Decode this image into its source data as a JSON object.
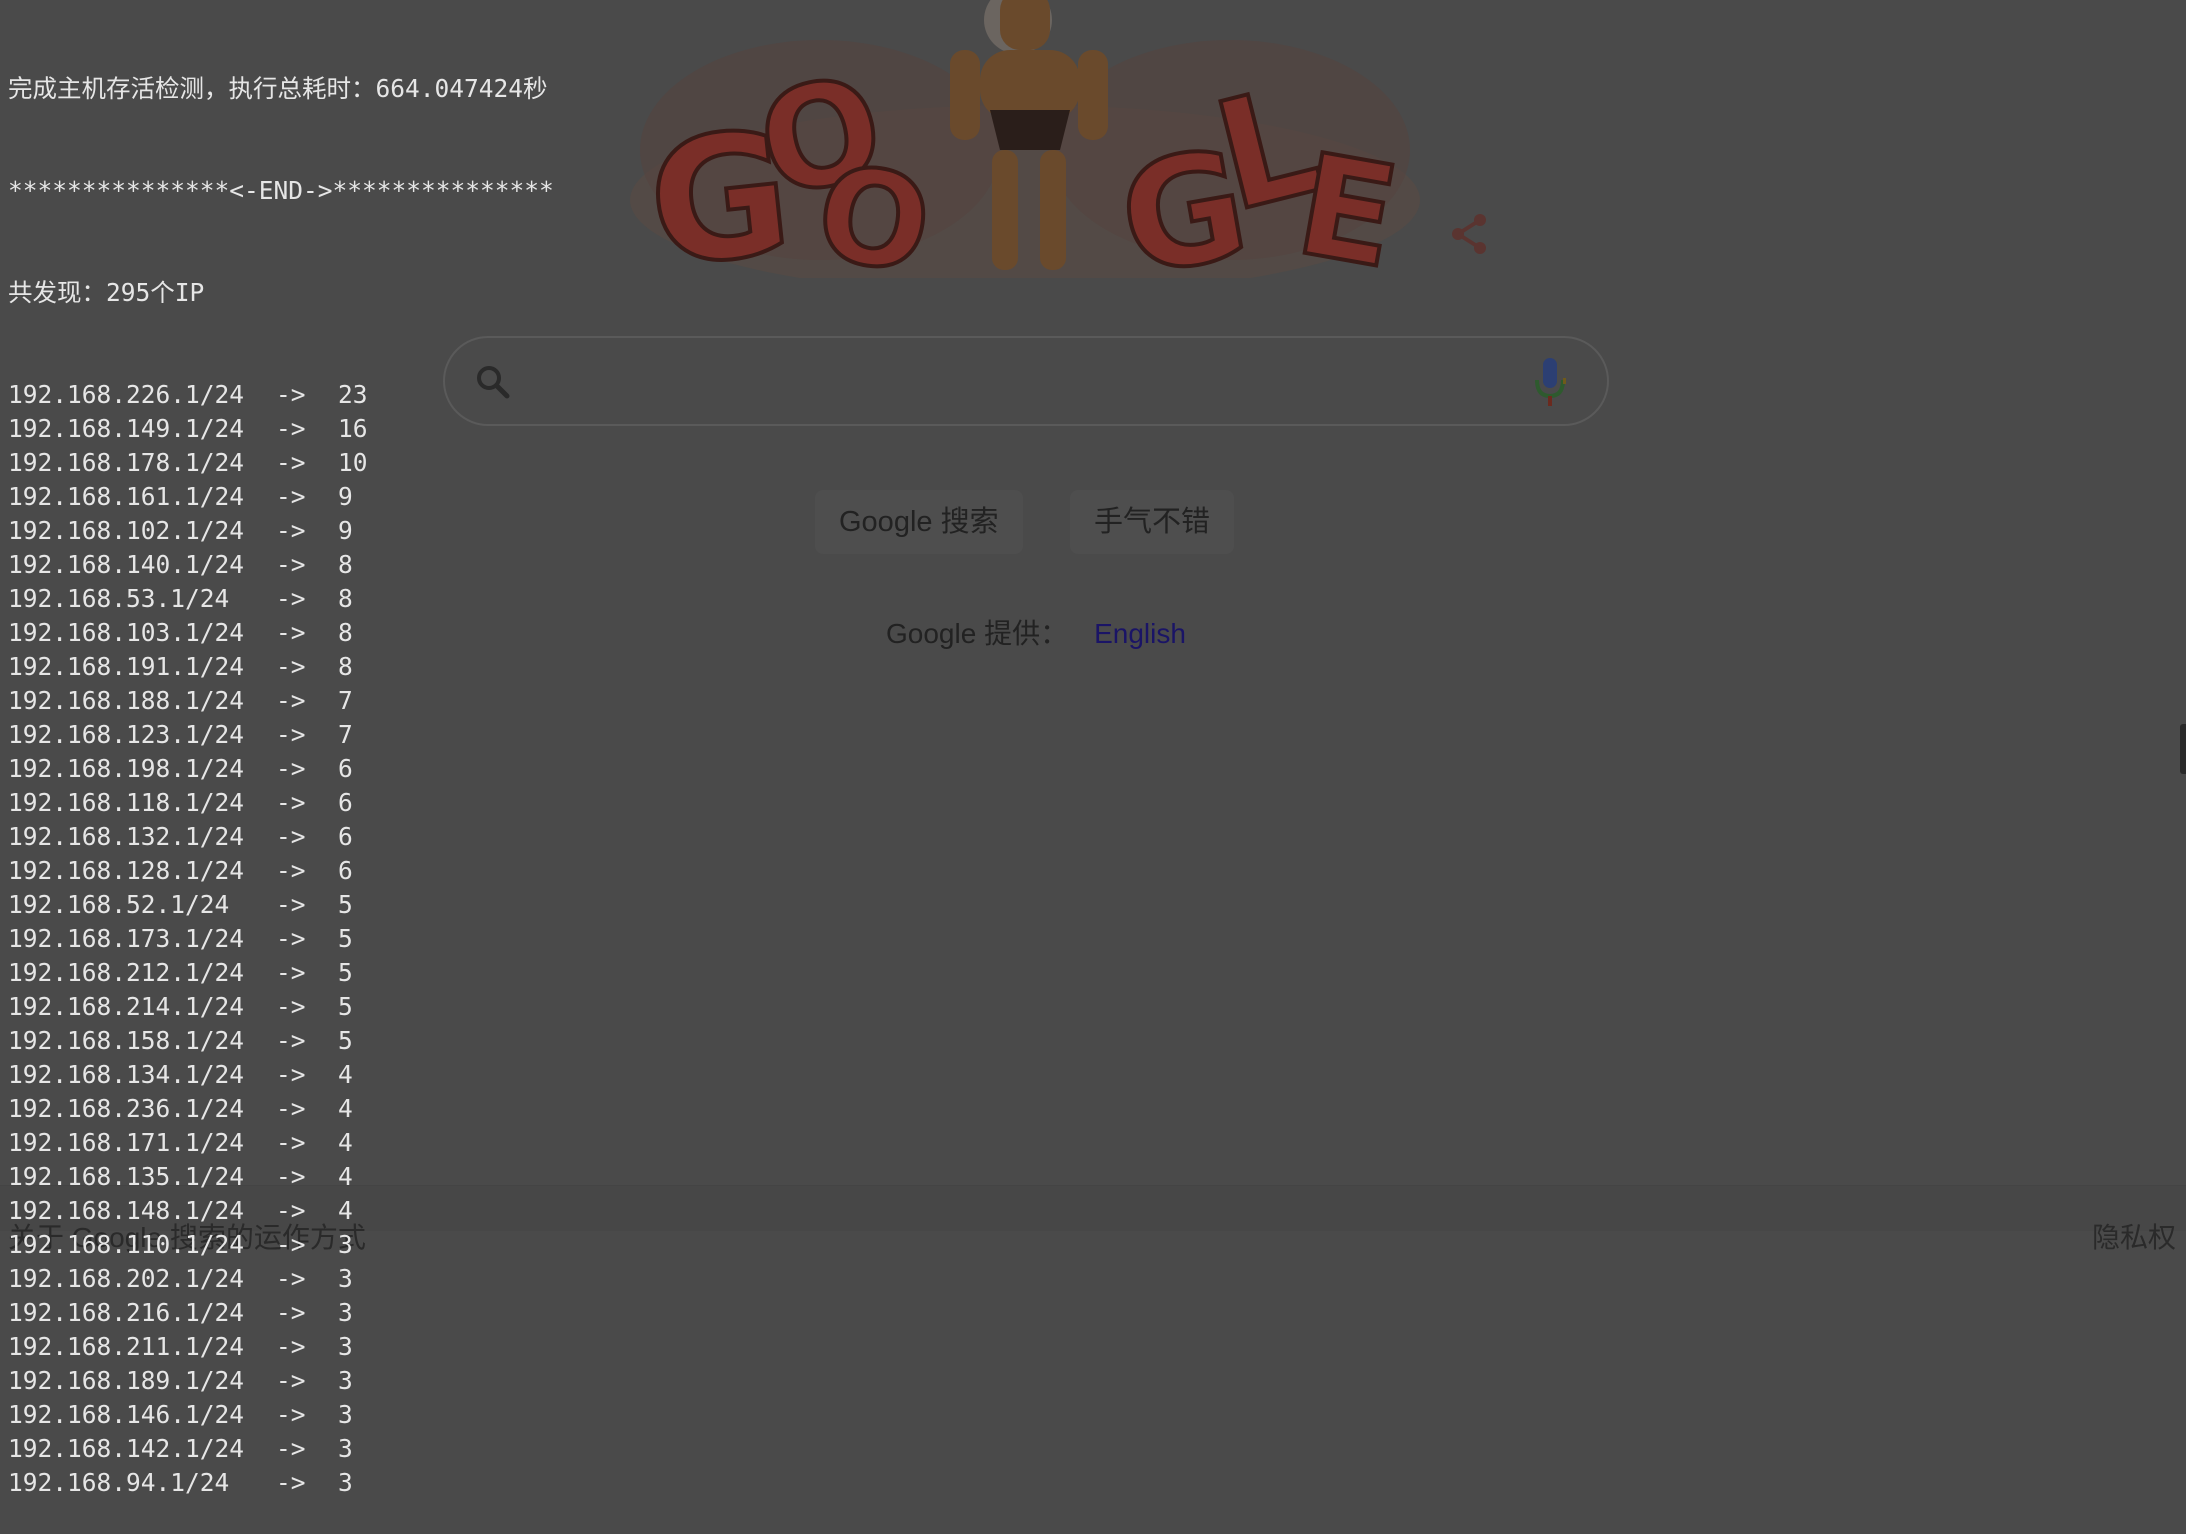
{
  "terminal": {
    "header_lines": [
      "完成主机存活检测，执行总耗时：664.047424秒",
      "***************<-END->***************",
      "共发现：295个IP"
    ],
    "arrow": "->",
    "rows": [
      {
        "ip": "192.168.226.1/24",
        "count": "23"
      },
      {
        "ip": "192.168.149.1/24",
        "count": "16"
      },
      {
        "ip": "192.168.178.1/24",
        "count": "10"
      },
      {
        "ip": "192.168.161.1/24",
        "count": "9"
      },
      {
        "ip": "192.168.102.1/24",
        "count": "9"
      },
      {
        "ip": "192.168.140.1/24",
        "count": "8"
      },
      {
        "ip": "192.168.53.1/24",
        "count": "8"
      },
      {
        "ip": "192.168.103.1/24",
        "count": "8"
      },
      {
        "ip": "192.168.191.1/24",
        "count": "8"
      },
      {
        "ip": "192.168.188.1/24",
        "count": "7"
      },
      {
        "ip": "192.168.123.1/24",
        "count": "7"
      },
      {
        "ip": "192.168.198.1/24",
        "count": "6"
      },
      {
        "ip": "192.168.118.1/24",
        "count": "6"
      },
      {
        "ip": "192.168.132.1/24",
        "count": "6"
      },
      {
        "ip": "192.168.128.1/24",
        "count": "6"
      },
      {
        "ip": "192.168.52.1/24",
        "count": "5"
      },
      {
        "ip": "192.168.173.1/24",
        "count": "5"
      },
      {
        "ip": "192.168.212.1/24",
        "count": "5"
      },
      {
        "ip": "192.168.214.1/24",
        "count": "5"
      },
      {
        "ip": "192.168.158.1/24",
        "count": "5"
      },
      {
        "ip": "192.168.134.1/24",
        "count": "4"
      },
      {
        "ip": "192.168.236.1/24",
        "count": "4"
      },
      {
        "ip": "192.168.171.1/24",
        "count": "4"
      },
      {
        "ip": "192.168.135.1/24",
        "count": "4"
      },
      {
        "ip": "192.168.148.1/24",
        "count": "4"
      },
      {
        "ip": "192.168.110.1/24",
        "count": "3"
      },
      {
        "ip": "192.168.202.1/24",
        "count": "3"
      },
      {
        "ip": "192.168.216.1/24",
        "count": "3"
      },
      {
        "ip": "192.168.211.1/24",
        "count": "3"
      },
      {
        "ip": "192.168.189.1/24",
        "count": "3"
      },
      {
        "ip": "192.168.146.1/24",
        "count": "3"
      },
      {
        "ip": "192.168.142.1/24",
        "count": "3"
      },
      {
        "ip": "192.168.94.1/24",
        "count": "3"
      }
    ]
  },
  "google": {
    "doodle_letters": [
      "G",
      "O",
      "O",
      "G",
      "L",
      "E"
    ],
    "search_value": "",
    "search_button": "Google 搜索",
    "lucky_button": "手气不错",
    "lang_prefix": "Google 提供：",
    "lang_link": "English",
    "footer_left": "关于 Google 搜索的运作方式",
    "footer_right": "隐私权"
  },
  "colors": {
    "background": "#4a4a4a",
    "terminal_text": "#e6e6e6",
    "link": "#1a1466",
    "doodle_red": "#7a2e28"
  },
  "icons": [
    "search-icon",
    "mic-icon",
    "share-icon"
  ]
}
